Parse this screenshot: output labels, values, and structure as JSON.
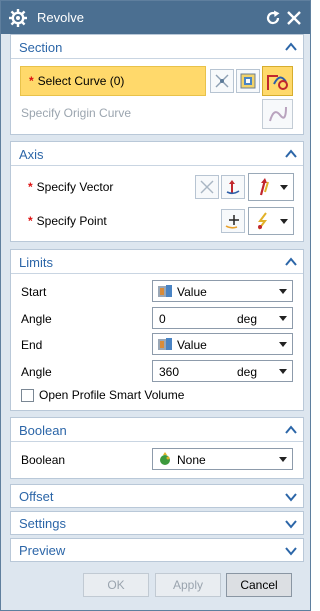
{
  "title": "Revolve",
  "sections": {
    "section": {
      "label": "Section",
      "select_curve": "Select Curve (0)",
      "specify_origin_curve": "Specify Origin Curve"
    },
    "axis": {
      "label": "Axis",
      "specify_vector": "Specify Vector",
      "specify_point": "Specify Point"
    },
    "limits": {
      "label": "Limits",
      "start_label": "Start",
      "start_value": "Value",
      "start_angle_label": "Angle",
      "start_angle_value": "0",
      "start_angle_unit": "deg",
      "end_label": "End",
      "end_value": "Value",
      "end_angle_label": "Angle",
      "end_angle_value": "360",
      "end_angle_unit": "deg",
      "open_profile": "Open Profile Smart Volume"
    },
    "boolean": {
      "label": "Boolean",
      "boolean_label": "Boolean",
      "boolean_value": "None"
    },
    "offset": {
      "label": "Offset"
    },
    "settings": {
      "label": "Settings"
    },
    "preview": {
      "label": "Preview"
    }
  },
  "buttons": {
    "ok": "OK",
    "apply": "Apply",
    "cancel": "Cancel"
  },
  "colors": {
    "titlebar": "#4b6f91",
    "section_header": "#2c66a8",
    "selection_highlight": "#ffd96b",
    "required_star": "#dd1111"
  },
  "icons": [
    "gear-icon",
    "reset-icon",
    "close-icon",
    "chevron-up-icon",
    "chevron-down-icon",
    "curve-rule-icon",
    "feature-curve-icon",
    "select-curve-icon",
    "origin-curve-icon",
    "vector-icon",
    "point-dialog-icon",
    "value-icon",
    "boolean-none-icon"
  ]
}
